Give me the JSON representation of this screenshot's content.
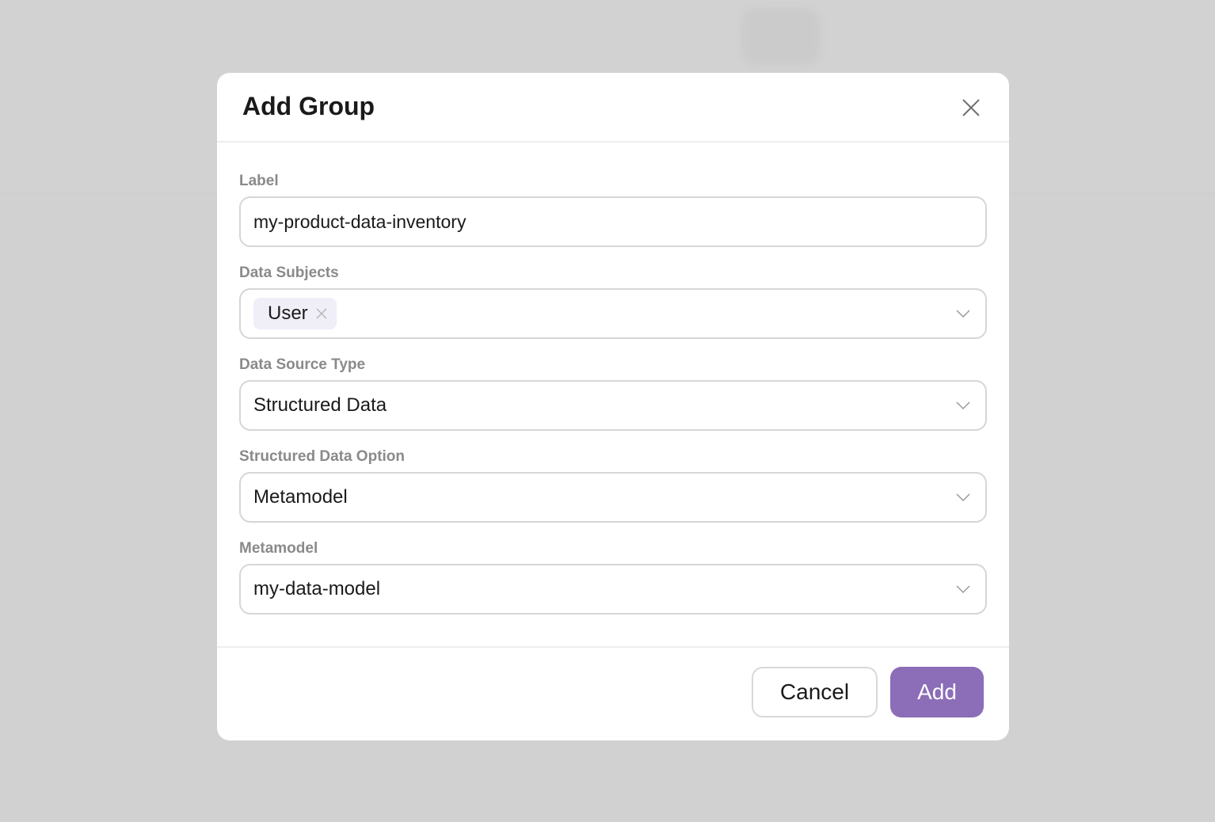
{
  "modal": {
    "title": "Add Group",
    "close_icon": "close-icon",
    "fields": {
      "label": {
        "label": "Label",
        "value": "my-product-data-inventory"
      },
      "data_subjects": {
        "label": "Data Subjects",
        "tags": [
          {
            "label": "User",
            "remove_icon": "close-icon"
          }
        ],
        "dropdown_icon": "chevron-down-icon"
      },
      "data_source_type": {
        "label": "Data Source Type",
        "value": "Structured Data",
        "dropdown_icon": "chevron-down-icon"
      },
      "structured_data_option": {
        "label": "Structured Data Option",
        "value": "Metamodel",
        "dropdown_icon": "chevron-down-icon"
      },
      "metamodel": {
        "label": "Metamodel",
        "value": "my-data-model",
        "dropdown_icon": "chevron-down-icon"
      }
    },
    "footer": {
      "cancel_label": "Cancel",
      "add_label": "Add"
    }
  },
  "colors": {
    "accent": "#8b6db8",
    "tag_bg": "#f0eef7",
    "overlay": "#d1d1d1",
    "label_text": "#8a8a8a",
    "border": "#d6d6d6"
  }
}
